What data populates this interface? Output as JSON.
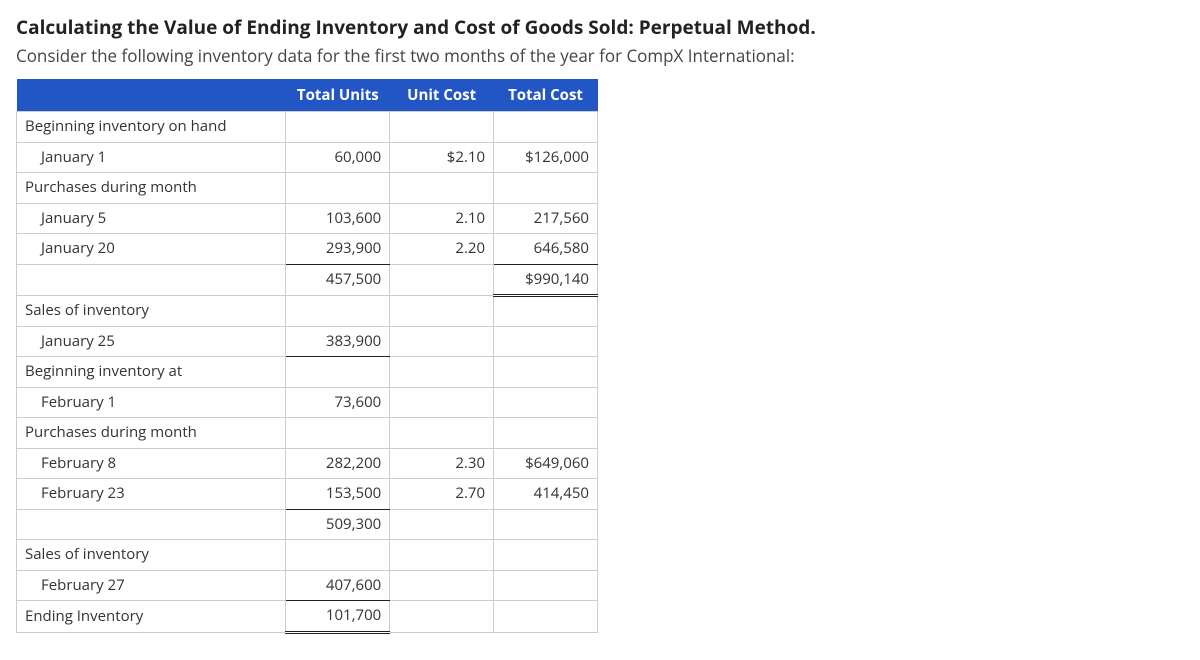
{
  "heading": {
    "title": "Calculating the Value of Ending Inventory and Cost of Goods Sold: Perpetual Method.",
    "subtitle": "Consider the following inventory data for the first two months of the year for CompX International:"
  },
  "columns": {
    "c1": "Total Units",
    "c2": "Unit Cost",
    "c3": "Total Cost"
  },
  "rows": {
    "begInvHand": "Beginning inventory on hand",
    "jan1": {
      "label": "January 1",
      "units": "60,000",
      "cost": "$2.10",
      "total": "$126,000"
    },
    "purchMonth1": "Purchases during month",
    "jan5": {
      "label": "January 5",
      "units": "103,600",
      "cost": "2.10",
      "total": "217,560"
    },
    "jan20": {
      "label": "January 20",
      "units": "293,900",
      "cost": "2.20",
      "total": "646,580"
    },
    "sumJan": {
      "units": "457,500",
      "total": "$990,140"
    },
    "salesInv1": "Sales of inventory",
    "jan25": {
      "label": "January 25",
      "units": "383,900"
    },
    "begInvAt": "Beginning inventory at",
    "feb1": {
      "label": "February 1",
      "units": "73,600"
    },
    "purchMonth2": "Purchases during month",
    "feb8": {
      "label": "February 8",
      "units": "282,200",
      "cost": "2.30",
      "total": "$649,060"
    },
    "feb23": {
      "label": "February 23",
      "units": "153,500",
      "cost": "2.70",
      "total": "414,450"
    },
    "sumFeb": {
      "units": "509,300"
    },
    "salesInv2": "Sales of inventory",
    "feb27": {
      "label": "February 27",
      "units": "407,600"
    },
    "endInv": {
      "label": "Ending Inventory",
      "units": "101,700"
    }
  }
}
